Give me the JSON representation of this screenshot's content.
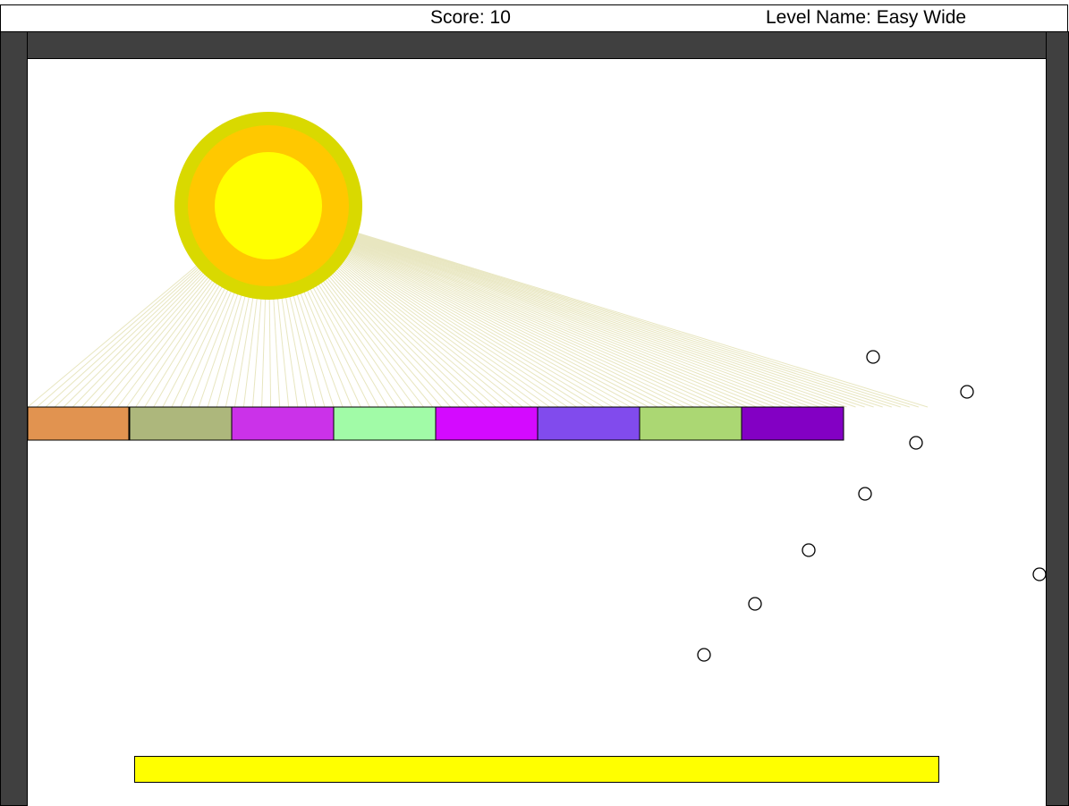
{
  "hud": {
    "score_text": "Score: 10",
    "level_text": "Level Name: Easy Wide"
  },
  "colors": {
    "background": "#ffffff",
    "wall": "#404040",
    "paddle": "#ffff00",
    "sun_outer": "#d9d900",
    "sun_middle": "#ffc800",
    "sun_inner": "#ffff00",
    "sun_rays": "#e8e6c0",
    "ball_stroke": "#000000"
  },
  "bricks": [
    {
      "color": "#e19350"
    },
    {
      "color": "#adb77c"
    },
    {
      "color": "#cb32e9"
    },
    {
      "color": "#a1fba7"
    },
    {
      "color": "#d40aff"
    },
    {
      "color": "#814bed"
    },
    {
      "color": "#abd773"
    },
    {
      "color": "#8300c4"
    }
  ],
  "balls_count": 8
}
